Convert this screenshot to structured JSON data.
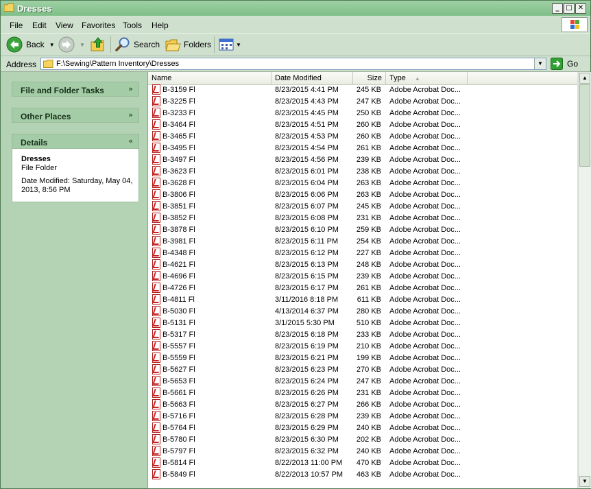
{
  "window": {
    "title": "Dresses"
  },
  "menu": [
    "File",
    "Edit",
    "View",
    "Favorites",
    "Tools",
    "Help"
  ],
  "toolbar": {
    "back": "Back",
    "search": "Search",
    "folders": "Folders"
  },
  "address": {
    "label": "Address",
    "path": "F:\\Sewing\\Pattern Inventory\\Dresses",
    "go": "Go"
  },
  "left_pane": {
    "tasks_title": "File and Folder Tasks",
    "other_title": "Other Places",
    "details_title": "Details",
    "details": {
      "name": "Dresses",
      "type": "File Folder",
      "modified": "Date Modified: Saturday, May 04, 2013, 8:56 PM"
    }
  },
  "columns": {
    "name": "Name",
    "date": "Date Modified",
    "size": "Size",
    "type": "Type"
  },
  "files": [
    {
      "name": "B-3159 Fl",
      "date": "8/23/2015 4:41 PM",
      "size": "245 KB",
      "type": "Adobe Acrobat Doc..."
    },
    {
      "name": "B-3225 Fl",
      "date": "8/23/2015 4:43 PM",
      "size": "247 KB",
      "type": "Adobe Acrobat Doc..."
    },
    {
      "name": "B-3233 Fl",
      "date": "8/23/2015 4:45 PM",
      "size": "250 KB",
      "type": "Adobe Acrobat Doc..."
    },
    {
      "name": "B-3464 Fl",
      "date": "8/23/2015 4:51 PM",
      "size": "260 KB",
      "type": "Adobe Acrobat Doc..."
    },
    {
      "name": "B-3465 Fl",
      "date": "8/23/2015 4:53 PM",
      "size": "260 KB",
      "type": "Adobe Acrobat Doc..."
    },
    {
      "name": "B-3495 Fl",
      "date": "8/23/2015 4:54 PM",
      "size": "261 KB",
      "type": "Adobe Acrobat Doc..."
    },
    {
      "name": "B-3497 Fl",
      "date": "8/23/2015 4:56 PM",
      "size": "239 KB",
      "type": "Adobe Acrobat Doc..."
    },
    {
      "name": "B-3623 Fl",
      "date": "8/23/2015 6:01 PM",
      "size": "238 KB",
      "type": "Adobe Acrobat Doc..."
    },
    {
      "name": "B-3628 Fl",
      "date": "8/23/2015 6:04 PM",
      "size": "263 KB",
      "type": "Adobe Acrobat Doc..."
    },
    {
      "name": "B-3806 Fl",
      "date": "8/23/2015 6:06 PM",
      "size": "263 KB",
      "type": "Adobe Acrobat Doc..."
    },
    {
      "name": "B-3851 Fl",
      "date": "8/23/2015 6:07 PM",
      "size": "245 KB",
      "type": "Adobe Acrobat Doc..."
    },
    {
      "name": "B-3852 Fl",
      "date": "8/23/2015 6:08 PM",
      "size": "231 KB",
      "type": "Adobe Acrobat Doc..."
    },
    {
      "name": "B-3878 Fl",
      "date": "8/23/2015 6:10 PM",
      "size": "259 KB",
      "type": "Adobe Acrobat Doc..."
    },
    {
      "name": "B-3981 Fl",
      "date": "8/23/2015 6:11 PM",
      "size": "254 KB",
      "type": "Adobe Acrobat Doc..."
    },
    {
      "name": "B-4348 Fl",
      "date": "8/23/2015 6:12 PM",
      "size": "227 KB",
      "type": "Adobe Acrobat Doc..."
    },
    {
      "name": "B-4621 Fl",
      "date": "8/23/2015 6:13 PM",
      "size": "248 KB",
      "type": "Adobe Acrobat Doc..."
    },
    {
      "name": "B-4696 Fl",
      "date": "8/23/2015 6:15 PM",
      "size": "239 KB",
      "type": "Adobe Acrobat Doc..."
    },
    {
      "name": "B-4726 Fl",
      "date": "8/23/2015 6:17 PM",
      "size": "261 KB",
      "type": "Adobe Acrobat Doc..."
    },
    {
      "name": "B-4811 Fl",
      "date": "3/11/2016 8:18 PM",
      "size": "611 KB",
      "type": "Adobe Acrobat Doc..."
    },
    {
      "name": "B-5030 Fl",
      "date": "4/13/2014 6:37 PM",
      "size": "280 KB",
      "type": "Adobe Acrobat Doc..."
    },
    {
      "name": "B-5131 Fl",
      "date": "3/1/2015 5:30 PM",
      "size": "510 KB",
      "type": "Adobe Acrobat Doc..."
    },
    {
      "name": "B-5317 Fl",
      "date": "8/23/2015 6:18 PM",
      "size": "233 KB",
      "type": "Adobe Acrobat Doc..."
    },
    {
      "name": "B-5557 Fl",
      "date": "8/23/2015 6:19 PM",
      "size": "210 KB",
      "type": "Adobe Acrobat Doc..."
    },
    {
      "name": "B-5559 Fl",
      "date": "8/23/2015 6:21 PM",
      "size": "199 KB",
      "type": "Adobe Acrobat Doc..."
    },
    {
      "name": "B-5627 Fl",
      "date": "8/23/2015 6:23 PM",
      "size": "270 KB",
      "type": "Adobe Acrobat Doc..."
    },
    {
      "name": "B-5653 Fl",
      "date": "8/23/2015 6:24 PM",
      "size": "247 KB",
      "type": "Adobe Acrobat Doc..."
    },
    {
      "name": "B-5661 Fl",
      "date": "8/23/2015 6:26 PM",
      "size": "231 KB",
      "type": "Adobe Acrobat Doc..."
    },
    {
      "name": "B-5663 Fl",
      "date": "8/23/2015 6:27 PM",
      "size": "266 KB",
      "type": "Adobe Acrobat Doc..."
    },
    {
      "name": "B-5716 Fl",
      "date": "8/23/2015 6:28 PM",
      "size": "239 KB",
      "type": "Adobe Acrobat Doc..."
    },
    {
      "name": "B-5764 Fl",
      "date": "8/23/2015 6:29 PM",
      "size": "240 KB",
      "type": "Adobe Acrobat Doc..."
    },
    {
      "name": "B-5780 Fl",
      "date": "8/23/2015 6:30 PM",
      "size": "202 KB",
      "type": "Adobe Acrobat Doc..."
    },
    {
      "name": "B-5797 Fl",
      "date": "8/23/2015 6:32 PM",
      "size": "240 KB",
      "type": "Adobe Acrobat Doc..."
    },
    {
      "name": "B-5814 Fl",
      "date": "8/22/2013 11:00 PM",
      "size": "470 KB",
      "type": "Adobe Acrobat Doc..."
    },
    {
      "name": "B-5849 Fl",
      "date": "8/22/2013 10:57 PM",
      "size": "463 KB",
      "type": "Adobe Acrobat Doc..."
    }
  ]
}
